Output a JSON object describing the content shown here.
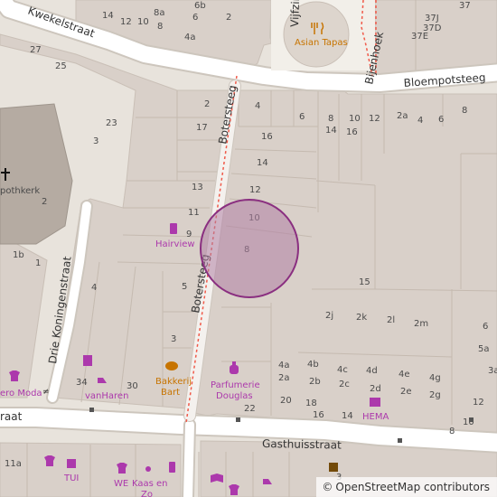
{
  "map": {
    "streets": {
      "kwekelstraat": "Kwekelstraat",
      "vijfzinnen": "Vijfzin",
      "bijenhoek": "Bijenhoek",
      "bloempotsteeg": "Bloempotsteeg",
      "botersteeg_north": "Botersteeg",
      "botersteeg_south": "Botersteeg",
      "drie_koningenstraat": "Drie Koningenstraat",
      "gasthuisstraat": "Gasthuisstraat",
      "straat_west": "raat"
    },
    "church_label": "pothkerk",
    "pois": {
      "asian_tapas": "Asian Tapas",
      "hairview": "Hairview",
      "bakkerij_bart_line1": "Bakkerij",
      "bakkerij_bart_line2": "Bart",
      "parfumerie_line1": "Parfumerie",
      "parfumerie_line2": "Douglas",
      "hema": "HEMA",
      "vanharen": "vanHaren",
      "ero_moda": "ero Moda",
      "tui": "TUI",
      "we": "WE",
      "kaas_line1": "Kaas en",
      "kaas_line2": "Zo"
    },
    "house_numbers": [
      "14",
      "12",
      "10",
      "8a",
      "8",
      "6b",
      "6",
      "2",
      "4a",
      "37",
      "37J",
      "37D",
      "37E",
      "27",
      "25",
      "23",
      "3",
      "17",
      "2",
      "4",
      "6",
      "8",
      "14",
      "10",
      "16",
      "12",
      "2a",
      "4",
      "6",
      "8",
      "16",
      "14",
      "13",
      "12",
      "11",
      "10",
      "9",
      "8",
      "2",
      "1b",
      "1",
      "5",
      "15",
      "4",
      "3",
      "34",
      "30",
      "2j",
      "2k",
      "2l",
      "2m",
      "4a",
      "4b",
      "4c",
      "4d",
      "4e",
      "4g",
      "2a",
      "2b",
      "2c",
      "2d",
      "2e",
      "2g",
      "20",
      "18",
      "16",
      "14",
      "22",
      "12",
      "10",
      "8",
      "6",
      "5a",
      "3a",
      "11a",
      "3"
    ],
    "poi_colors": {
      "food": "#c77400",
      "shop": "#ac39ac",
      "circle_fill": "#b07fa4",
      "circle_stroke": "#8a2f80",
      "footway": "#f05a4a"
    }
  },
  "attribution": {
    "copyright": "©",
    "text": "OpenStreetMap contributors"
  }
}
